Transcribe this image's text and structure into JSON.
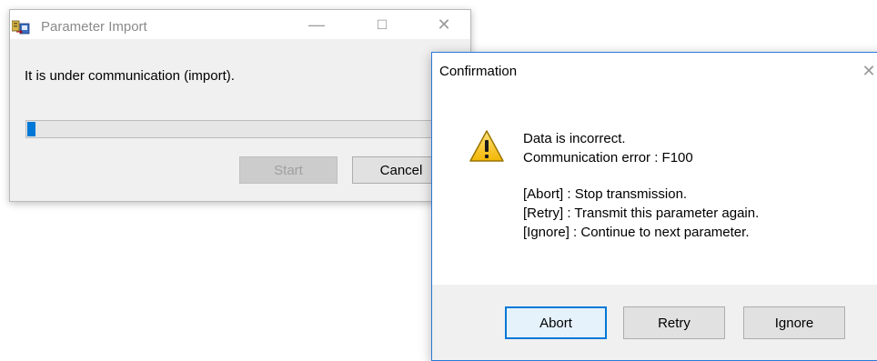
{
  "import_window": {
    "title": "Parameter Import",
    "minimize_glyph": "—",
    "maximize_glyph": "☐",
    "close_glyph": "✕",
    "message": "It is under communication (import).",
    "progress": 0.02,
    "start_label": "Start",
    "cancel_label": "Cancel",
    "icon": "parameter-import-app-icon"
  },
  "confirm_dialog": {
    "title": "Confirmation",
    "close_glyph": "✕",
    "icon": "warning-icon",
    "lines": [
      "Data is incorrect.",
      "Communication error : F100",
      "[Abort] : Stop transmission.",
      "[Retry] : Transmit this parameter again.",
      "[Ignore] : Continue to next parameter."
    ],
    "buttons": {
      "abort": "Abort",
      "retry": "Retry",
      "ignore": "Ignore"
    }
  },
  "colors": {
    "accent": "#0078d7",
    "warning_fill": "#f5c518"
  }
}
